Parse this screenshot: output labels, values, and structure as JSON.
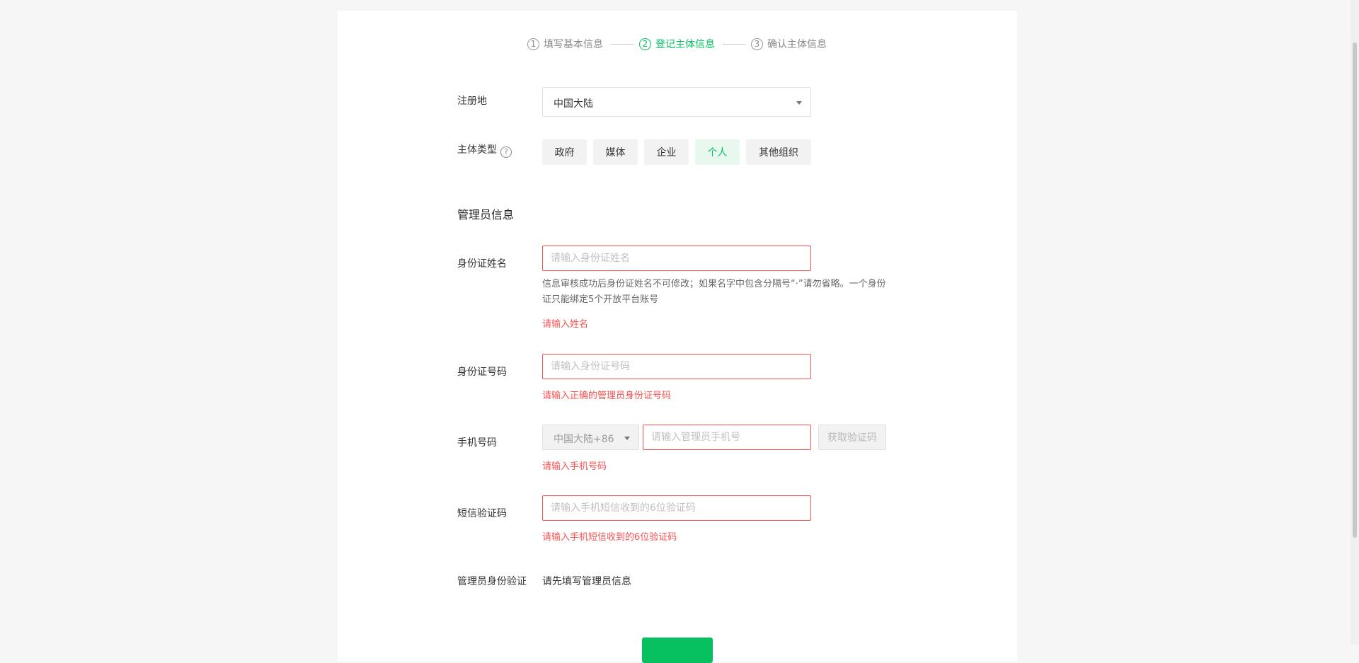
{
  "steps": [
    {
      "num": "1",
      "label": "填写基本信息"
    },
    {
      "num": "2",
      "label": "登记主体信息"
    },
    {
      "num": "3",
      "label": "确认主体信息"
    }
  ],
  "register_location": {
    "label": "注册地",
    "value": "中国大陆"
  },
  "entity_type": {
    "label": "主体类型",
    "help": "?",
    "options": [
      "政府",
      "媒体",
      "企业",
      "个人",
      "其他组织"
    ],
    "selected": "个人"
  },
  "admin_section_title": "管理员信息",
  "id_name": {
    "label": "身份证姓名",
    "placeholder": "请输入身份证姓名",
    "hint_line1": "信息审核成功后身份证姓名不可修改；如果名字中包含分隔号“·”请勿省略。一个身份",
    "hint_line2": "证只能绑定5个开放平台账号",
    "error": "请输入姓名"
  },
  "id_number": {
    "label": "身份证号码",
    "placeholder": "请输入身份证号码",
    "error": "请输入正确的管理员身份证号码"
  },
  "phone": {
    "label": "手机号码",
    "prefix": "中国大陆+86",
    "placeholder": "请输入管理员手机号",
    "code_button": "获取验证码",
    "error": "请输入手机号码"
  },
  "sms_code": {
    "label": "短信验证码",
    "placeholder": "请输入手机短信收到的6位验证码",
    "error": "请输入手机短信收到的6位验证码"
  },
  "admin_verify": {
    "label": "管理员身份验证",
    "text": "请先填写管理员信息"
  },
  "colors": {
    "accent": "#07c160",
    "error": "#fa5151",
    "page_bg": "#f6f6f6"
  }
}
